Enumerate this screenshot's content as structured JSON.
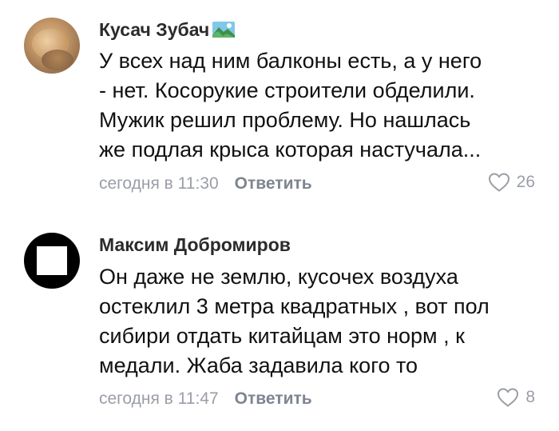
{
  "comments": [
    {
      "author": "Кусач Зубач",
      "badge_icon": "landscape-badge-icon",
      "lines": [
        "У всех над ним балконы есть, а у него",
        "- нет. Косорукие строители обделили.",
        "Мужик решил проблему. Но нашлась",
        "же подлая крыса которая настучала..."
      ],
      "timestamp": "сегодня в 11:30",
      "reply_label": "Ответить",
      "likes": "26",
      "like_icon": "heart-outline-icon"
    },
    {
      "author": "Максим Добромиров",
      "lines": [
        "Он даже не землю, кусочех воздуха",
        "остеклил 3 метра квадратных , вот пол",
        "сибири отдать китайцам это норм , к",
        "медали. Жаба задавила кого то"
      ],
      "timestamp": "сегодня в 11:47",
      "reply_label": "Ответить",
      "likes": "8",
      "like_icon": "heart-outline-icon"
    }
  ],
  "colors": {
    "meta_text": "#9a9ea6",
    "reply_text": "#7d8590",
    "body_text": "#111111"
  }
}
